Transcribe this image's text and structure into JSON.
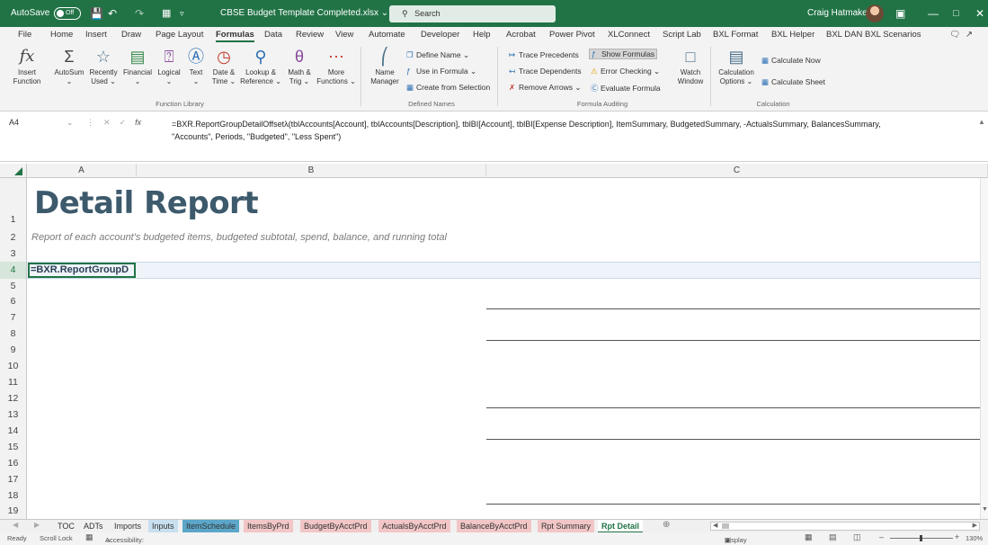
{
  "titlebar": {
    "autosave_label": "AutoSave",
    "autosave_state": "Off",
    "filename": "CBSE Budget Template Completed.xlsx",
    "search_placeholder": "Search",
    "user_name": "Craig Hatmaker",
    "bg_color": "#217346"
  },
  "menu": {
    "items": [
      "File",
      "Home",
      "Insert",
      "Draw",
      "Page Layout",
      "Formulas",
      "Data",
      "Review",
      "View",
      "Automate",
      "Developer",
      "Help",
      "Acrobat",
      "Power Pivot",
      "XLConnect",
      "Script Lab",
      "BXL Format",
      "BXL Helper",
      "BXL DAN",
      "BXL Scenarios"
    ],
    "active": "Formulas"
  },
  "ribbon": {
    "function_library": {
      "label": "Function Library",
      "insert_function": [
        "Insert",
        "Function"
      ],
      "autosum": "AutoSum",
      "recently_used": [
        "Recently",
        "Used"
      ],
      "financial": "Financial",
      "logical": "Logical",
      "text": "Text",
      "date_time": [
        "Date &",
        "Time"
      ],
      "lookup_reference": [
        "Lookup &",
        "Reference"
      ],
      "math_trig": [
        "Math &",
        "Trig"
      ],
      "more_functions": [
        "More",
        "Functions"
      ]
    },
    "defined_names": {
      "label": "Defined Names",
      "name_manager": [
        "Name",
        "Manager"
      ],
      "define_name": "Define Name",
      "use_in_formula": "Use in Formula",
      "create_from_selection": "Create from Selection"
    },
    "formula_auditing": {
      "label": "Formula Auditing",
      "trace_precedents": "Trace Precedents",
      "trace_dependents": "Trace Dependents",
      "remove_arrows": "Remove Arrows",
      "show_formulas": "Show Formulas",
      "error_checking": "Error Checking",
      "evaluate_formula": "Evaluate Formula",
      "watch_window": [
        "Watch",
        "Window"
      ]
    },
    "calculation": {
      "label": "Calculation",
      "calculation_options": [
        "Calculation",
        "Options"
      ],
      "calculate_now": "Calculate Now",
      "calculate_sheet": "Calculate Sheet"
    }
  },
  "formula_bar": {
    "name_box": "A4",
    "fx": "fx",
    "formula_line1": "=BXR.ReportGroupDetailOffsetλ(tblAccounts[Account], tblAccounts[Description], tblBI[Account], tblBI[Expense Description], ItemSummary, BudgetedSummary, -ActualsSummary, BalancesSummary,",
    "formula_line2": "\"Accounts\", Periods, \"Budgeted\", \"Less Spent\")"
  },
  "grid": {
    "columns": [
      "A",
      "B",
      "C"
    ],
    "rows": [
      "1",
      "2",
      "3",
      "4",
      "5",
      "6",
      "7",
      "8",
      "9",
      "10",
      "11",
      "12",
      "13",
      "14",
      "15",
      "16",
      "17",
      "18",
      "19"
    ],
    "title": "Detail Report",
    "subtitle": "Report of each account's budgeted items, budgeted subtotal, spend, balance, and running total",
    "active_cell_text": "=BXR.ReportGroupD",
    "title_color": "#3d5a6c"
  },
  "sheet_tabs": {
    "tabs": [
      {
        "label": "TOC",
        "color": ""
      },
      {
        "label": "ADTs",
        "color": ""
      },
      {
        "label": "Imports",
        "color": ""
      },
      {
        "label": "Inputs",
        "color": "#c8dff0"
      },
      {
        "label": "ItemSchedule",
        "color": "#5ba6c9"
      },
      {
        "label": "ItemsByPrd",
        "color": "#f2c6c6"
      },
      {
        "label": "BudgetByAcctPrd",
        "color": "#f2c6c6"
      },
      {
        "label": "ActualsByAcctPrd",
        "color": "#f2c6c6"
      },
      {
        "label": "BalanceByAcctPrd",
        "color": "#f2c6c6"
      },
      {
        "label": "Rpt Summary",
        "color": "#f2c6c6"
      },
      {
        "label": "Rpt Detail",
        "color": ""
      }
    ],
    "active": "Rpt Detail"
  },
  "status_bar": {
    "ready": "Ready",
    "scroll_lock": "Scroll Lock",
    "accessibility": "Accessibility: Investigate",
    "display_settings": "Display Settings",
    "zoom": "130%"
  }
}
